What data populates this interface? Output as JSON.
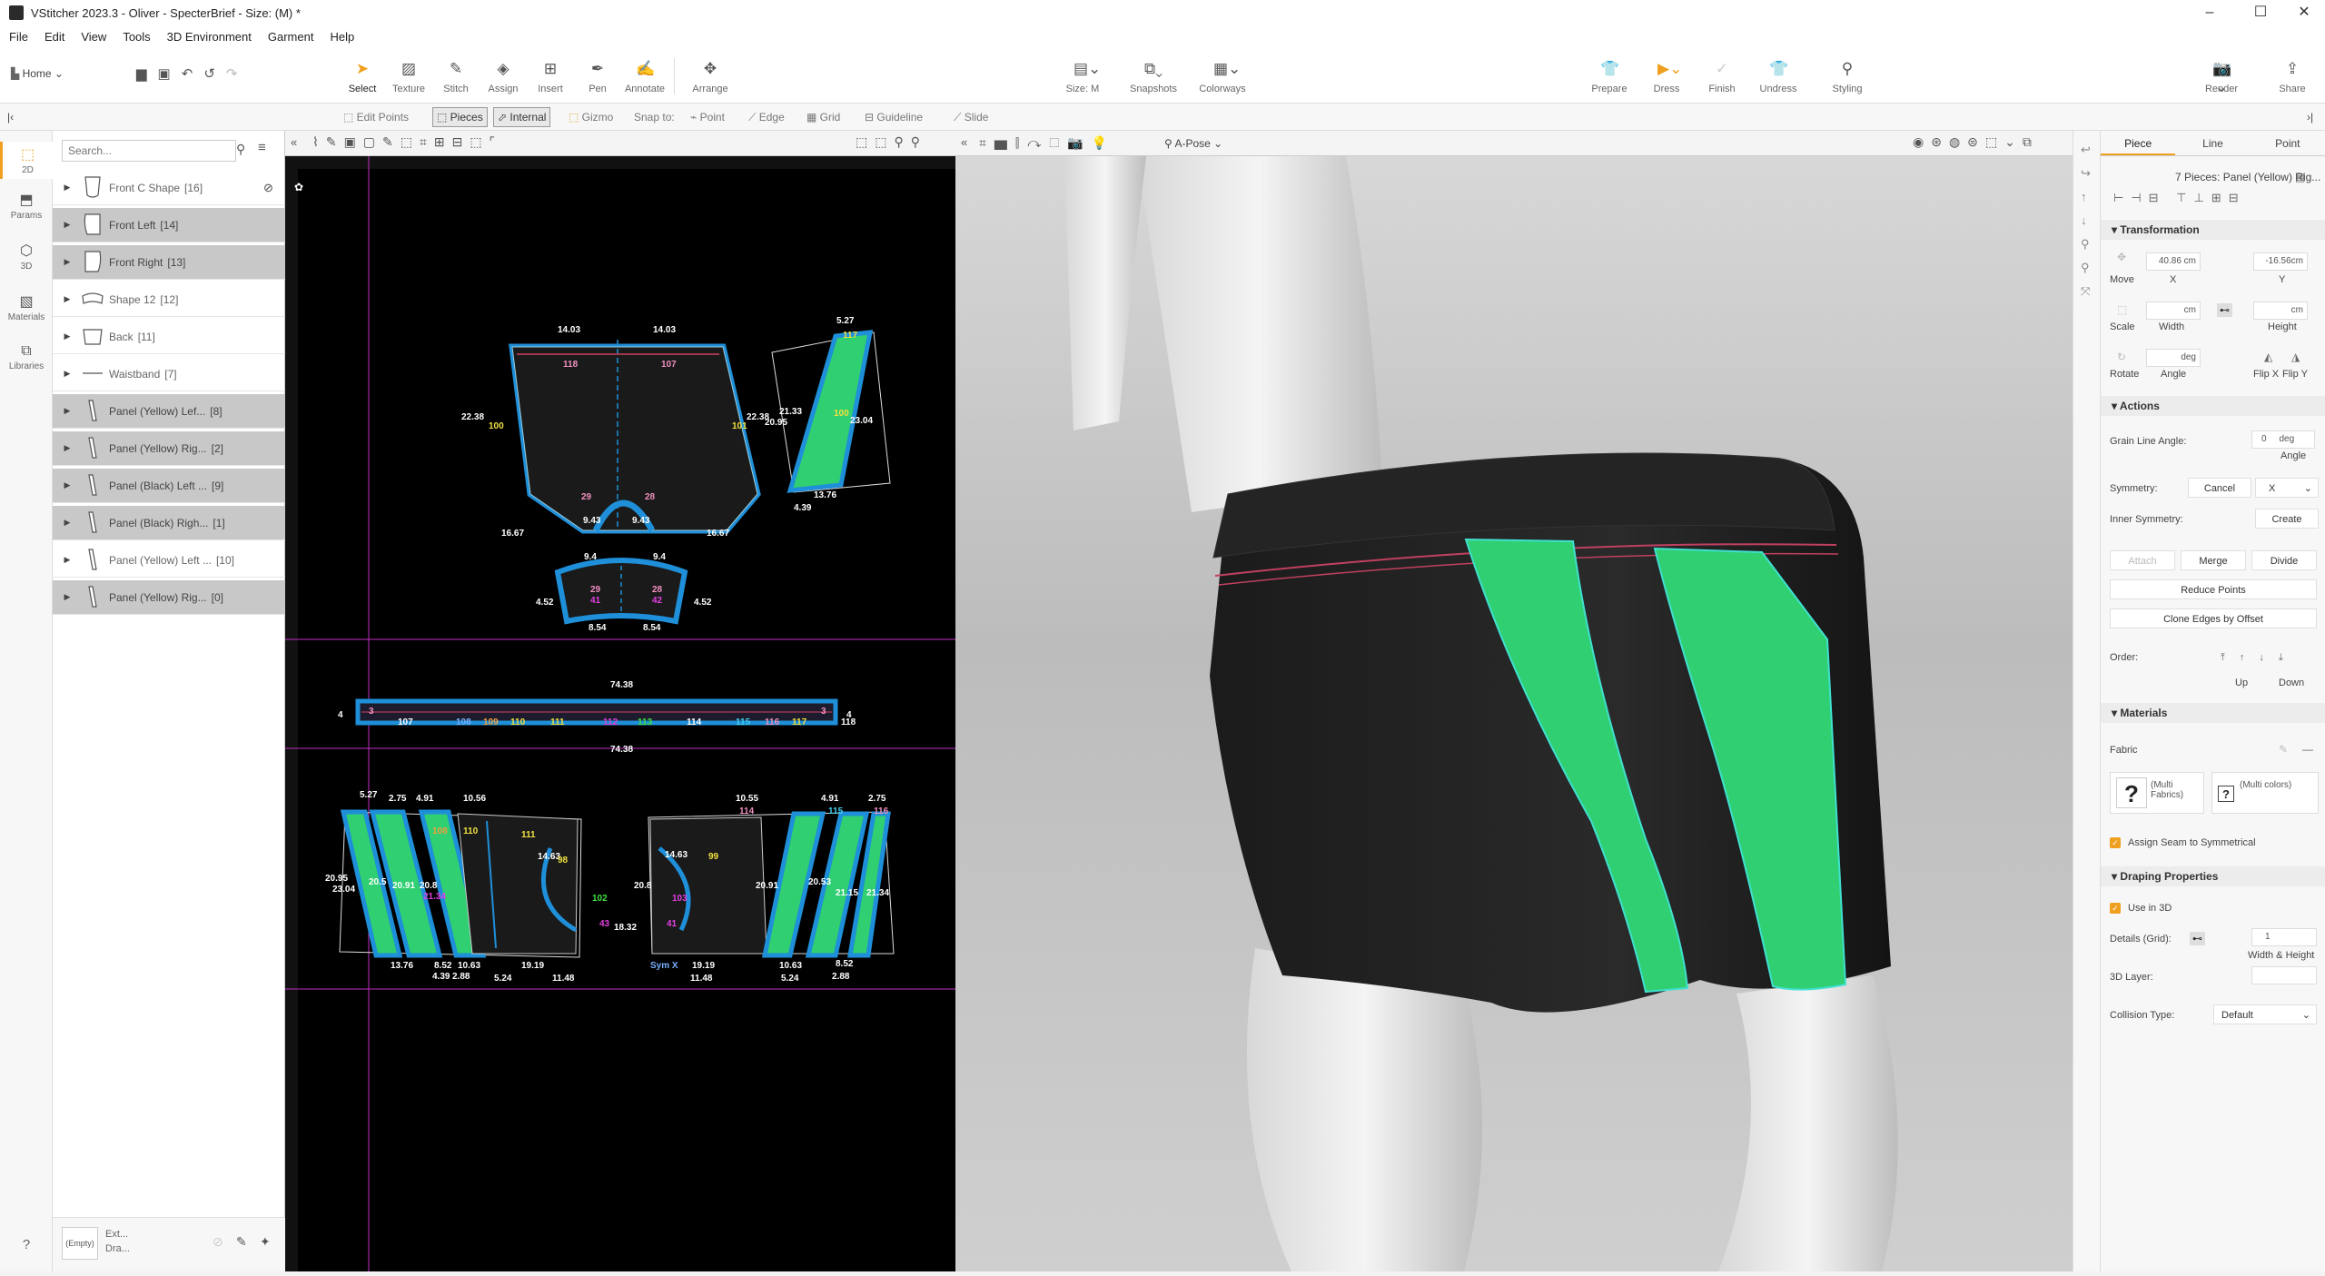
{
  "window": {
    "title": "VStitcher 2023.3 - Oliver - SpecterBrief - Size: (M) *",
    "minimize": "–",
    "maximize": "☐",
    "close": "✕"
  },
  "menu": [
    "File",
    "Edit",
    "View",
    "Tools",
    "3D Environment",
    "Garment",
    "Help"
  ],
  "toolbar": {
    "home": "Home",
    "tools": [
      {
        "label": "Select",
        "icon": "cursor-icon"
      },
      {
        "label": "Texture",
        "icon": "texture-icon"
      },
      {
        "label": "Stitch",
        "icon": "stitch-icon"
      },
      {
        "label": "Assign",
        "icon": "assign-icon"
      },
      {
        "label": "Insert",
        "icon": "insert-icon"
      },
      {
        "label": "Pen",
        "icon": "pen-icon"
      },
      {
        "label": "Annotate",
        "icon": "annotate-icon"
      },
      {
        "label": "Arrange",
        "icon": "arrange-icon"
      }
    ],
    "center_tools": [
      {
        "label": "Size: M",
        "icon": "size-icon"
      },
      {
        "label": "Snapshots",
        "icon": "snapshots-icon"
      },
      {
        "label": "Colorways",
        "icon": "colorways-icon"
      }
    ],
    "sim_tools": [
      {
        "label": "Prepare",
        "icon": "prepare-icon"
      },
      {
        "label": "Dress",
        "icon": "dress-icon"
      },
      {
        "label": "Finish",
        "icon": "finish-icon"
      },
      {
        "label": "Undress",
        "icon": "undress-icon"
      },
      {
        "label": "Styling",
        "icon": "styling-icon"
      }
    ],
    "right_tools": [
      {
        "label": "Render",
        "icon": "render-icon"
      },
      {
        "label": "Share",
        "icon": "share-icon"
      }
    ]
  },
  "subbar": {
    "edit_points": "Edit Points",
    "pieces": "Pieces",
    "internal": "Internal",
    "gizmo": "Gizmo",
    "snap_to": "Snap to:",
    "point": "Point",
    "edge": "Edge",
    "grid": "Grid",
    "guideline": "Guideline",
    "slide": "Slide"
  },
  "rail": [
    {
      "label": "2D",
      "icon": "2d-icon"
    },
    {
      "label": "Params",
      "icon": "params-icon"
    },
    {
      "label": "3D",
      "icon": "3d-icon"
    },
    {
      "label": "Materials",
      "icon": "materials-icon"
    },
    {
      "label": "Libraries",
      "icon": "libraries-icon"
    }
  ],
  "piece_list": {
    "search_placeholder": "Search...",
    "items": [
      {
        "name": "Front C Shape",
        "count": "[16]",
        "highlight": false
      },
      {
        "name": "Front Left",
        "count": "[14]",
        "highlight": true
      },
      {
        "name": "Front Right",
        "count": "[13]",
        "highlight": true
      },
      {
        "name": "Shape 12",
        "count": "[12]",
        "highlight": false
      },
      {
        "name": "Back",
        "count": "[11]",
        "highlight": false
      },
      {
        "name": "Waistband",
        "count": "[7]",
        "highlight": false
      },
      {
        "name": "Panel (Yellow) Lef...",
        "count": "[8]",
        "highlight": true
      },
      {
        "name": "Panel (Yellow) Rig...",
        "count": "[2]",
        "highlight": true
      },
      {
        "name": "Panel (Black) Left ...",
        "count": "[9]",
        "highlight": true
      },
      {
        "name": "Panel (Black) Righ...",
        "count": "[1]",
        "highlight": true
      },
      {
        "name": "Panel (Yellow) Left ...",
        "count": "[10]",
        "highlight": false
      },
      {
        "name": "Panel (Yellow) Rig...",
        "count": "[0]",
        "highlight": true
      }
    ],
    "footer_empty": "(Empty)",
    "footer_ext": "Ext...",
    "footer_dra": "Dra..."
  },
  "viewport3d": {
    "pose": "A-Pose"
  },
  "props": {
    "tabs": [
      "Piece",
      "Line",
      "Point"
    ],
    "selection": "7 Pieces: Panel (Yellow) Rig...",
    "transformation": "Transformation",
    "move": "Move",
    "x_value": "40.86 cm",
    "x_label": "X",
    "y_value": "-16.56cm",
    "y_label": "Y",
    "scale": "Scale",
    "width_unit": "cm",
    "height_unit": "cm",
    "width": "Width",
    "height": "Height",
    "rotate": "Rotate",
    "angle_unit": "deg",
    "angle": "Angle",
    "flip_x": "Flip X",
    "flip_y": "Flip Y",
    "actions": "Actions",
    "grain_line_angle": "Grain Line Angle:",
    "grain_value": "0",
    "grain_unit": "deg",
    "grain_angle": "Angle",
    "symmetry": "Symmetry:",
    "cancel": "Cancel",
    "symmetry_axis": "X",
    "inner_symmetry": "Inner Symmetry:",
    "create": "Create",
    "attach": "Attach",
    "merge": "Merge",
    "divide": "Divide",
    "reduce_points": "Reduce Points",
    "clone_edges": "Clone Edges by Offset",
    "order": "Order:",
    "up": "Up",
    "down": "Down",
    "materials": "Materials",
    "fabric": "Fabric",
    "multi_fabrics": "(Multi Fabrics)",
    "multi_colors": "(Multi colors)",
    "assign_seam": "Assign Seam to Symmetrical",
    "draping": "Draping Properties",
    "use_in_3d": "Use in 3D",
    "details_grid": "Details (Grid):",
    "details_value": "1",
    "width_height": "Width & Height",
    "layer_3d": "3D Layer:",
    "collision_type": "Collision Type:",
    "collision_value": "Default"
  },
  "pattern_labels": {
    "front_top": [
      "14.03",
      "14.03",
      "118",
      "107"
    ],
    "front_side": [
      "22.38",
      "100",
      "101",
      "22.38"
    ],
    "front_bottom": [
      "29",
      "28",
      "9.43",
      "9.43",
      "16.67",
      "16.67"
    ],
    "gusset": [
      "9.4",
      "9.4",
      "29",
      "28",
      "41",
      "42",
      "4.52",
      "4.52",
      "8.54",
      "8.54"
    ],
    "right_piece": [
      "5.27",
      "117",
      "20.95",
      "21.33",
      "100",
      "23.04",
      "13.76",
      "4.39"
    ],
    "waistband": [
      "74.38",
      "74.38",
      "4",
      "4",
      "3",
      "3",
      "107",
      "108",
      "109",
      "110",
      "111",
      "112",
      "113",
      "114",
      "115",
      "116",
      "117",
      "118"
    ],
    "back_left": [
      "5.27",
      "2.75",
      "4.91",
      "10.56",
      "20.95",
      "23.04",
      "20.5",
      "20.91",
      "20.8",
      "21.34",
      "14.63",
      "98",
      "102",
      "18.32",
      "13.76",
      "8.52",
      "10.63",
      "19.19",
      "4.39",
      "2.88",
      "5.24",
      "11.48",
      "108",
      "110",
      "111",
      "43"
    ],
    "back_right": [
      "10.55",
      "4.91",
      "2.75",
      "14.63",
      "99",
      "20.8",
      "103",
      "41",
      "20.91",
      "20.53",
      "21.15",
      "21.34",
      "19.19",
      "10.63",
      "8.52",
      "11.48",
      "5.24",
      "2.88",
      "114",
      "115",
      "116",
      "Sym X"
    ]
  },
  "colors": {
    "accent": "#f0a020",
    "panel_green": "#2fcf72",
    "seam_blue": "#1e8fd8",
    "guide_magenta": "#d030d0",
    "selection_bg": "#c8c8c8"
  }
}
